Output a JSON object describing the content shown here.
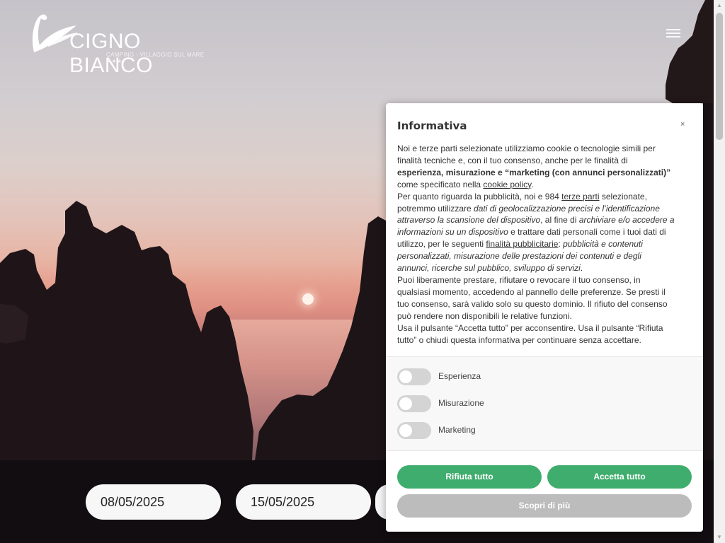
{
  "brand": {
    "name": "CIGNO BIANCO",
    "subtitle": "CAMPING - VILLAGGIO SUL MARE ★★★"
  },
  "booking": {
    "checkin": "08/05/2025",
    "checkout": "15/05/2025"
  },
  "cookie_dialog": {
    "title": "Informativa",
    "close_label": "×",
    "p1_a": "Noi e terze parti selezionate utilizziamo cookie o tecnologie simili per finalità tecniche e, con il tuo consenso, anche per le finalità di ",
    "p1_b": "esperienza, misurazione e “marketing (con annunci personalizzati)”",
    "p1_c": " come specificato nella ",
    "p1_link": "cookie policy",
    "p1_d": ".",
    "p2_a": "Per quanto riguarda la pubblicità, noi e 984 ",
    "p2_link1": "terze parti",
    "p2_b": " selezionate, potremmo utilizzare ",
    "p2_em1": "dati di geolocalizzazione precisi e l’identificazione attraverso la scansione del dispositivo",
    "p2_c": ", al fine di ",
    "p2_em2": "archiviare e/o accedere a informazioni su un dispositivo",
    "p2_d": " e trattare dati personali come i tuoi dati di utilizzo, per le seguenti ",
    "p2_link2": "finalità pubblicitarie",
    "p2_e": ": ",
    "p2_em3": "pubblicità e contenuti personalizzati, misurazione delle prestazioni dei contenuti e degli annunci, ricerche sul pubblico, sviluppo di servizi",
    "p2_f": ".",
    "p3": "Puoi liberamente prestare, rifiutare o revocare il tuo consenso, in qualsiasi momento, accedendo al pannello delle preferenze. Se presti il tuo consenso, sarà valido solo su questo dominio. Il rifiuto del consenso può rendere non disponibili le relative funzioni.",
    "p4": "Usa il pulsante “Accetta tutto” per acconsentire. Usa il pulsante “Rifiuta tutto” o chiudi questa informativa per continuare senza accettare.",
    "prefs": [
      {
        "label": "Esperienza",
        "enabled": false
      },
      {
        "label": "Misurazione",
        "enabled": false
      },
      {
        "label": "Marketing",
        "enabled": false
      }
    ],
    "reject_label": "Rifiuta tutto",
    "accept_label": "Accetta tutto",
    "more_label": "Scopri di più"
  },
  "colors": {
    "accept_green": "#3fad6d",
    "more_grey": "#bcbcbc",
    "toggle_off": "#d4d4d4"
  }
}
